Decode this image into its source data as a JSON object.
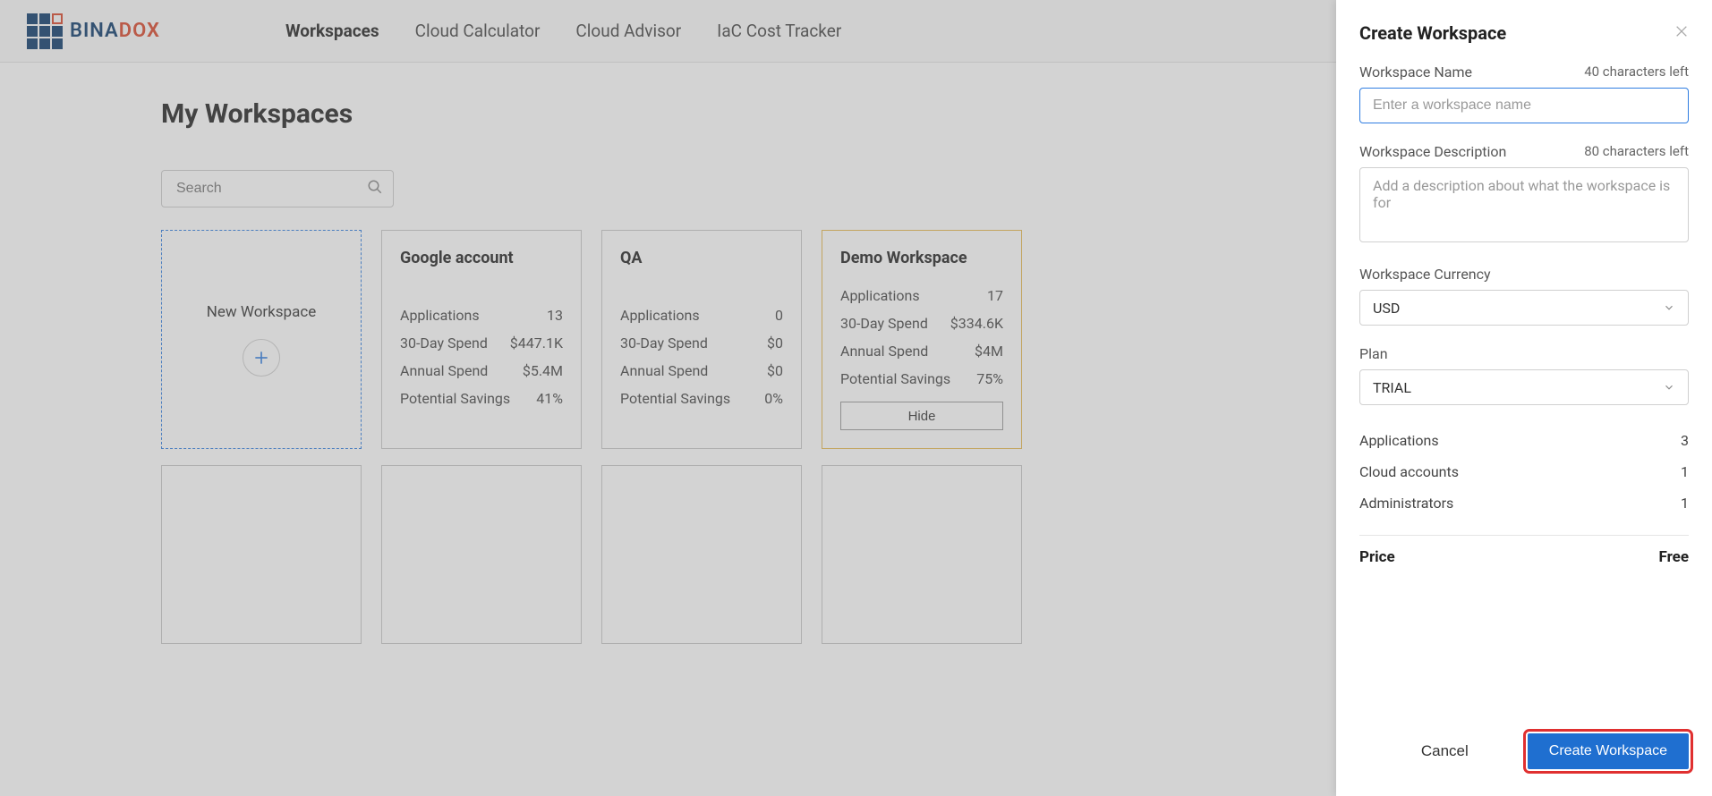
{
  "brand": {
    "name1": "BINA",
    "name2": "DOX"
  },
  "nav": {
    "items": [
      "Workspaces",
      "Cloud Calculator",
      "Cloud Advisor",
      "IaC Cost Tracker"
    ],
    "active": 0
  },
  "page_title": "My Workspaces",
  "search_placeholder": "Search",
  "new_workspace_label": "New Workspace",
  "workspaces": [
    {
      "title": "Google account",
      "stats": [
        {
          "label": "Applications",
          "value": "13"
        },
        {
          "label": "30-Day Spend",
          "value": "$447.1K"
        },
        {
          "label": "Annual Spend",
          "value": "$5.4M"
        },
        {
          "label": "Potential Savings",
          "value": "41%"
        }
      ]
    },
    {
      "title": "QA",
      "stats": [
        {
          "label": "Applications",
          "value": "0"
        },
        {
          "label": "30-Day Spend",
          "value": "$0"
        },
        {
          "label": "Annual Spend",
          "value": "$0"
        },
        {
          "label": "Potential Savings",
          "value": "0%"
        }
      ]
    },
    {
      "title": "Demo Workspace",
      "stats": [
        {
          "label": "Applications",
          "value": "17"
        },
        {
          "label": "30-Day Spend",
          "value": "$334.6K"
        },
        {
          "label": "Annual Spend",
          "value": "$4M"
        },
        {
          "label": "Potential Savings",
          "value": "75%"
        }
      ],
      "hide_label": "Hide"
    }
  ],
  "panel": {
    "title": "Create Workspace",
    "name_label": "Workspace Name",
    "name_hint": "40 characters left",
    "name_placeholder": "Enter a workspace name",
    "desc_label": "Workspace Description",
    "desc_hint": "80 characters left",
    "desc_placeholder": "Add a description about what the workspace is for",
    "currency_label": "Workspace Currency",
    "currency_value": "USD",
    "plan_label": "Plan",
    "plan_value": "TRIAL",
    "info": [
      {
        "label": "Applications",
        "value": "3"
      },
      {
        "label": "Cloud accounts",
        "value": "1"
      },
      {
        "label": "Administrators",
        "value": "1"
      }
    ],
    "price_label": "Price",
    "price_value": "Free",
    "cancel_label": "Cancel",
    "create_label": "Create Workspace"
  }
}
